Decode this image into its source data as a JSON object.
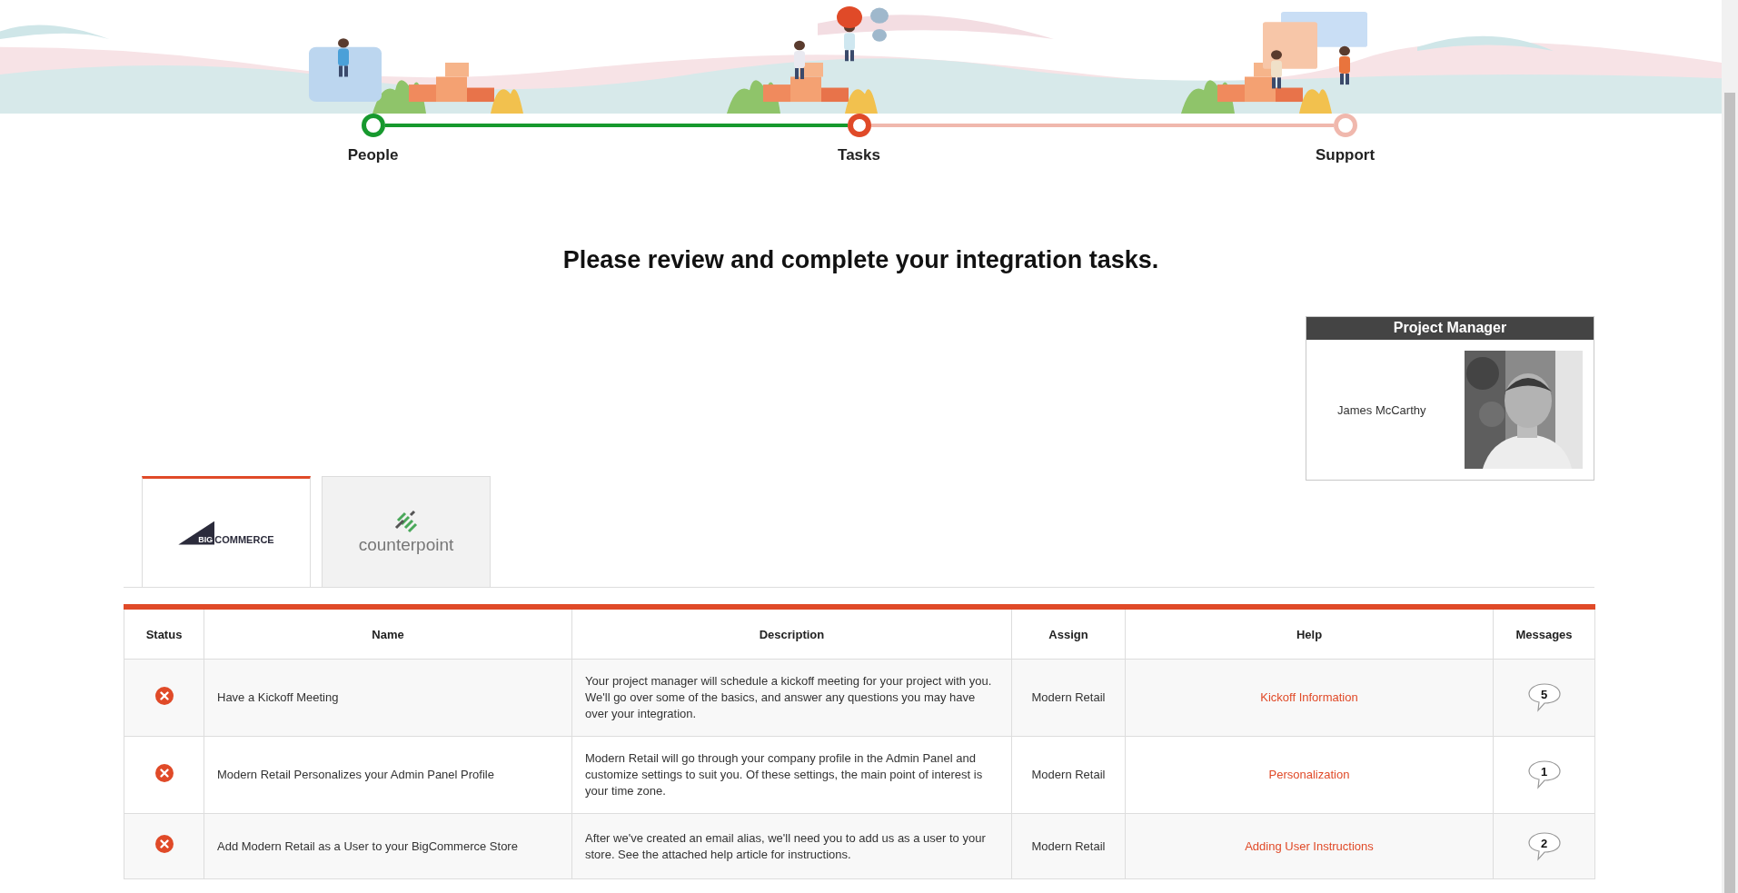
{
  "stepper": {
    "steps": [
      {
        "label": "People",
        "done": true,
        "selected": false
      },
      {
        "label": "Tasks",
        "done": false,
        "selected": true
      },
      {
        "label": "Support",
        "done": false,
        "selected": false
      }
    ]
  },
  "heading": "Please review and complete your integration tasks.",
  "project_manager": {
    "title": "Project Manager",
    "name": "James McCarthy"
  },
  "tabs": [
    {
      "kind": "bigcommerce",
      "label_mark": "BIG",
      "label": "COMMERCE",
      "selected": true
    },
    {
      "kind": "counterpoint",
      "label": "counterpoint",
      "selected": false
    }
  ],
  "table": {
    "columns": [
      "Status",
      "Name",
      "Description",
      "Assign",
      "Help",
      "Messages"
    ],
    "rows": [
      {
        "complete": false,
        "name": "Have a Kickoff Meeting",
        "description": "Your project manager will schedule a kickoff meeting for your project with you. We'll go over some of the basics, and answer any questions you may have over your integration.",
        "assign": "Modern Retail",
        "help": "Kickoff Information",
        "messages": "5"
      },
      {
        "complete": false,
        "name": "Modern Retail Personalizes your Admin Panel Profile",
        "description": "Modern Retail will go through your company profile in the Admin Panel and customize settings to suit you. Of these settings, the main point of interest is your time zone.",
        "assign": "Modern Retail",
        "help": "Personalization",
        "messages": "1"
      },
      {
        "complete": false,
        "name": "Add Modern Retail as a User to your BigCommerce Store",
        "description": "After we've created an email alias, we'll need you to add us as a user to your store. See the attached help article for instructions.",
        "assign": "Modern Retail",
        "help": "Adding User Instructions",
        "messages": "2"
      }
    ]
  }
}
